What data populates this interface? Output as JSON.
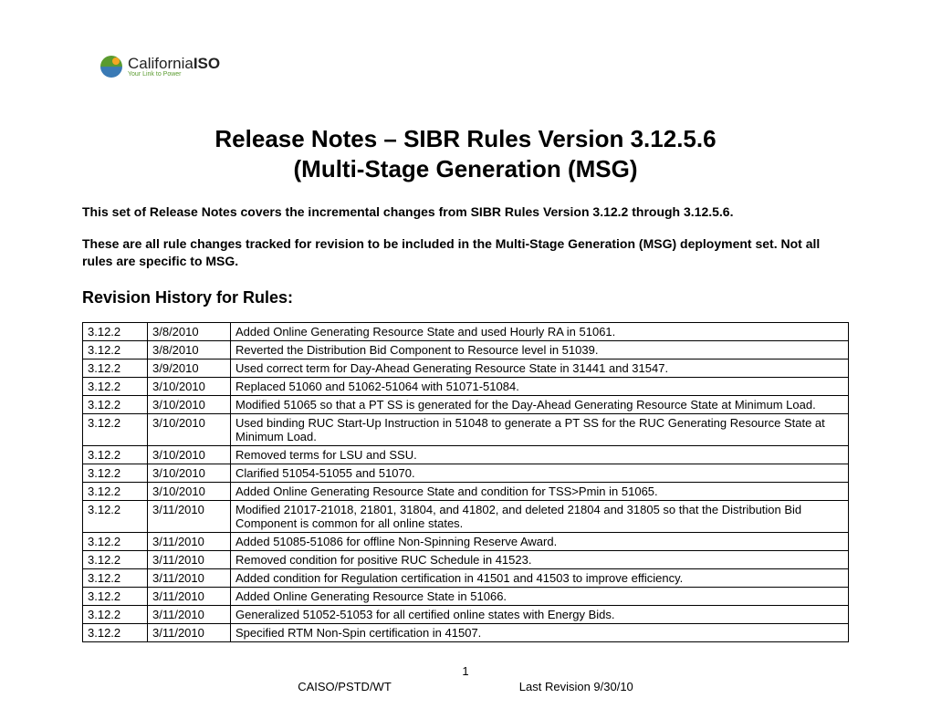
{
  "logo": {
    "brand_pre": "California",
    "brand_bold": "ISO",
    "tagline": "Your Link to Power"
  },
  "title": "Release Notes – SIBR Rules Version 3.12.5.6",
  "subtitle": "(Multi-Stage Generation (MSG)",
  "intro": "This set of Release Notes covers the incremental changes from SIBR Rules Version 3.12.2 through 3.12.5.6.",
  "note": "These are all rule changes tracked for revision to be included in the Multi-Stage Generation (MSG) deployment set. Not all rules are specific to MSG.",
  "section_heading": "Revision History for Rules:",
  "table": [
    {
      "v": "3.12.2",
      "d": "3/8/2010",
      "desc": "Added Online Generating Resource State and used Hourly RA in 51061."
    },
    {
      "v": "3.12.2",
      "d": "3/8/2010",
      "desc": "Reverted the Distribution Bid Component to Resource level in 51039."
    },
    {
      "v": "3.12.2",
      "d": "3/9/2010",
      "desc": "Used correct term for Day-Ahead Generating Resource State in 31441 and 31547."
    },
    {
      "v": "3.12.2",
      "d": "3/10/2010",
      "desc": "Replaced 51060 and 51062-51064 with 51071-51084."
    },
    {
      "v": "3.12.2",
      "d": "3/10/2010",
      "desc": "Modified 51065 so that a PT SS is generated for the Day-Ahead Generating Resource State at Minimum Load."
    },
    {
      "v": "3.12.2",
      "d": "3/10/2010",
      "desc": "Used binding RUC Start-Up Instruction in 51048 to generate a PT SS for the RUC Generating Resource State at Minimum Load."
    },
    {
      "v": "3.12.2",
      "d": "3/10/2010",
      "desc": "Removed terms for LSU and SSU."
    },
    {
      "v": "3.12.2",
      "d": "3/10/2010",
      "desc": "Clarified 51054-51055 and 51070."
    },
    {
      "v": "3.12.2",
      "d": "3/10/2010",
      "desc": "Added Online Generating Resource State and condition for TSS>Pmin in 51065."
    },
    {
      "v": "3.12.2",
      "d": "3/11/2010",
      "desc": "Modified 21017-21018, 21801, 31804, and 41802, and deleted 21804 and 31805 so that the Distribution Bid Component is common for all online states."
    },
    {
      "v": "3.12.2",
      "d": "3/11/2010",
      "desc": "Added 51085-51086 for offline Non-Spinning Reserve Award."
    },
    {
      "v": "3.12.2",
      "d": "3/11/2010",
      "desc": "Removed condition for positive RUC Schedule in 41523."
    },
    {
      "v": "3.12.2",
      "d": "3/11/2010",
      "desc": "Added condition for Regulation certification in 41501 and 41503 to improve efficiency."
    },
    {
      "v": "3.12.2",
      "d": "3/11/2010",
      "desc": "Added Online Generating Resource State in 51066."
    },
    {
      "v": "3.12.2",
      "d": "3/11/2010",
      "desc": "Generalized 51052-51053 for all certified online states with Energy Bids."
    },
    {
      "v": "3.12.2",
      "d": "3/11/2010",
      "desc": "Specified RTM Non-Spin certification in 41507."
    }
  ],
  "footer": {
    "page": "1",
    "left": "CAISO/PSTD/WT",
    "right": "Last Revision 9/30/10"
  }
}
